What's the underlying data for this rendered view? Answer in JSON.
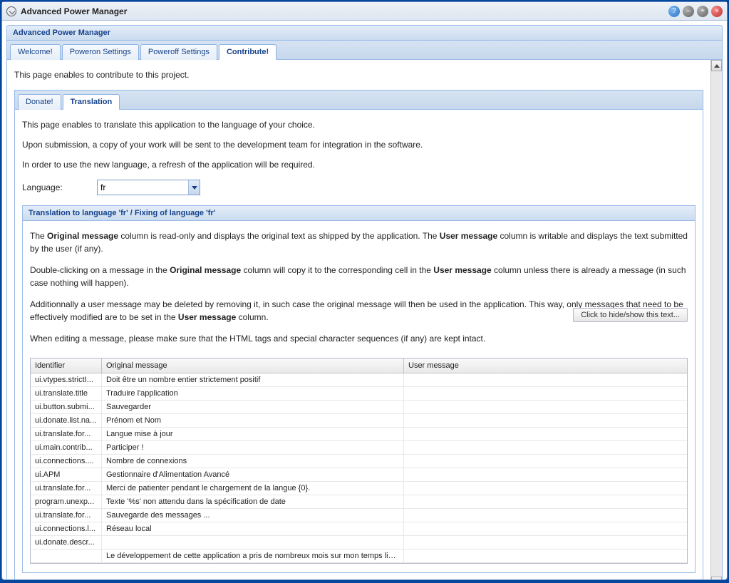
{
  "window": {
    "title": "Advanced Power Manager"
  },
  "panel": {
    "title": "Advanced Power Manager"
  },
  "tabs": [
    {
      "label": "Welcome!"
    },
    {
      "label": "Poweron Settings"
    },
    {
      "label": "Poweroff Settings"
    },
    {
      "label": "Contribute!"
    }
  ],
  "intro": "This page enables to contribute to this project.",
  "subtabs": [
    {
      "label": "Donate!"
    },
    {
      "label": "Translation"
    }
  ],
  "translate": {
    "p1": "This page enables to translate this application to the language of your choice.",
    "p2": "Upon submission, a copy of your work will be sent to the development team for integration in the software.",
    "p3": "In order to use the new language, a refresh of the application will be required.",
    "language_label": "Language:",
    "language_value": "fr"
  },
  "section": {
    "title": "Translation to language 'fr' / Fixing of language 'fr'",
    "info1_pre": "The ",
    "info1_b1": "Original message",
    "info1_mid1": " column is read-only and displays the original text as shipped by the application. The ",
    "info1_b2": "User message",
    "info1_post": " column is writable and displays the text submitted by the user (if any).",
    "info2_pre": "Double-clicking on a message in the ",
    "info2_b1": "Original message",
    "info2_mid": " column will copy it to the corresponding cell in the ",
    "info2_b2": "User message",
    "info2_post": " column unless there is already a message (in such case nothing will happen).",
    "info3_pre": "Additionnally a user message may be deleted by removing it, in such case the original message will then be used in the application. This way, only messages that need to be effectively modified are to be set in the ",
    "info3_b1": "User message",
    "info3_post": " column.",
    "info4": "When editing a message, please make sure that the HTML tags and special character sequences (if any) are kept intact.",
    "hide_btn": "Click to hide/show this text..."
  },
  "grid": {
    "headers": {
      "id": "Identifier",
      "orig": "Original message",
      "user": "User message"
    },
    "rows": [
      {
        "id": "ui.vtypes.strictI...",
        "orig": "Doit être un nombre entier strictement positif",
        "user": ""
      },
      {
        "id": "ui.translate.title",
        "orig": "Traduire l'application",
        "user": ""
      },
      {
        "id": "ui.button.submi...",
        "orig": "Sauvegarder",
        "user": ""
      },
      {
        "id": "ui.donate.list.na...",
        "orig": "Prénom et Nom",
        "user": ""
      },
      {
        "id": "ui.translate.for...",
        "orig": "Langue mise à jour",
        "user": ""
      },
      {
        "id": "ui.main.contrib...",
        "orig": "Participer !",
        "user": ""
      },
      {
        "id": "ui.connections....",
        "orig": "Nombre de connexions",
        "user": ""
      },
      {
        "id": "ui.APM",
        "orig": "Gestionnaire d'Alimentation Avancé",
        "user": ""
      },
      {
        "id": "ui.translate.for...",
        "orig": "Merci de patienter pendant le chargement de la langue {0}.",
        "user": ""
      },
      {
        "id": "program.unexp...",
        "orig": "Texte '%s' non attendu dans la spécification de date",
        "user": ""
      },
      {
        "id": "ui.translate.for...",
        "orig": "Sauvegarde des messages ...",
        "user": ""
      },
      {
        "id": "ui.connections.l...",
        "orig": "Réseau local",
        "user": ""
      },
      {
        "id": "ui.donate.descr...",
        "orig": "",
        "user": ""
      },
      {
        "id": "",
        "orig": "Le développement de cette application a pris de nombreux mois sur mon temps libre. L",
        "user": ""
      }
    ]
  }
}
